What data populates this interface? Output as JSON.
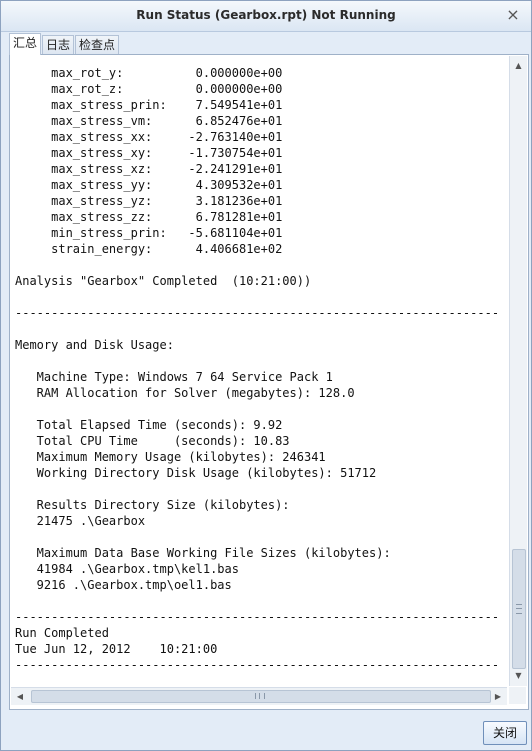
{
  "window": {
    "title": "Run Status (Gearbox.rpt) Not Running",
    "close_glyph": "×"
  },
  "tabs": [
    {
      "label": "汇总",
      "active": true
    },
    {
      "label": "日志",
      "active": false
    },
    {
      "label": "检查点",
      "active": false
    }
  ],
  "report": {
    "lines": [
      "     max_rot_y:          0.000000e+00",
      "     max_rot_z:          0.000000e+00",
      "     max_stress_prin:    7.549541e+01",
      "     max_stress_vm:      6.852476e+01",
      "     max_stress_xx:     -2.763140e+01",
      "     max_stress_xy:     -1.730754e+01",
      "     max_stress_xz:     -2.241291e+01",
      "     max_stress_yy:      4.309532e+01",
      "     max_stress_yz:      3.181236e+01",
      "     max_stress_zz:      6.781281e+01",
      "     min_stress_prin:   -5.681104e+01",
      "     strain_energy:      4.406681e+02",
      "",
      "Analysis \"Gearbox\" Completed  (10:21:00))",
      "",
      "-------------------------------------------------------------------",
      "",
      "Memory and Disk Usage:",
      "",
      "   Machine Type: Windows 7 64 Service Pack 1",
      "   RAM Allocation for Solver (megabytes): 128.0",
      "",
      "   Total Elapsed Time (seconds): 9.92",
      "   Total CPU Time     (seconds): 10.83",
      "   Maximum Memory Usage (kilobytes): 246341",
      "   Working Directory Disk Usage (kilobytes): 51712",
      "",
      "   Results Directory Size (kilobytes):",
      "   21475 .\\Gearbox",
      "",
      "   Maximum Data Base Working File Sizes (kilobytes):",
      "   41984 .\\Gearbox.tmp\\kel1.bas",
      "   9216 .\\Gearbox.tmp\\oel1.bas",
      "",
      "-------------------------------------------------------------------",
      "Run Completed",
      "Tue Jun 12, 2012    10:21:00",
      "-------------------------------------------------------------------"
    ]
  },
  "scrollbar": {
    "up_glyph": "▲",
    "down_glyph": "▼",
    "left_glyph": "◀",
    "right_glyph": "▶"
  },
  "footer": {
    "close_label": "关闭"
  }
}
